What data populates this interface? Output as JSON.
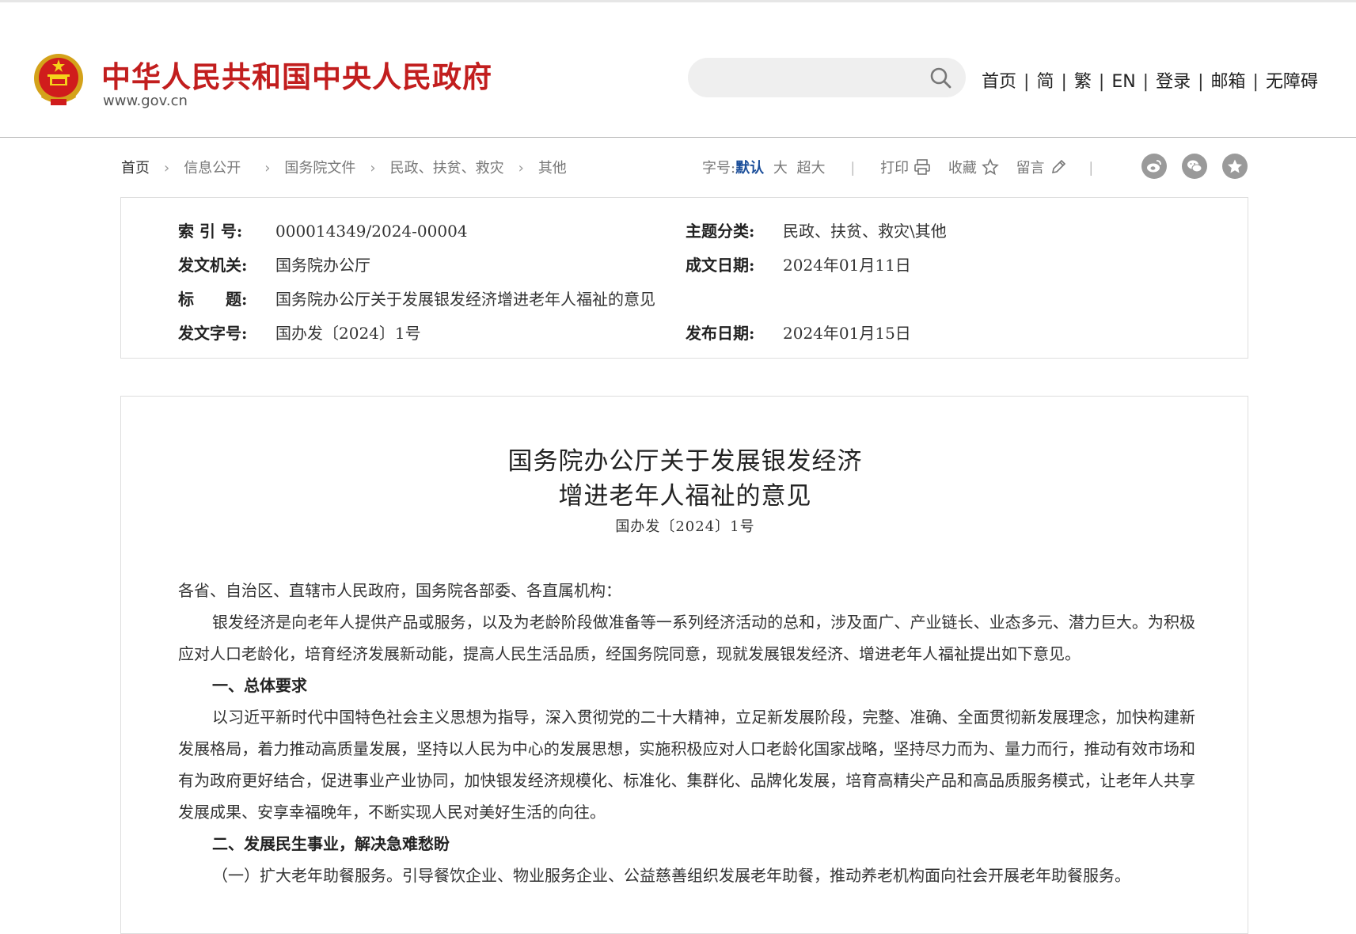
{
  "header": {
    "site_title": "中华人民共和国中央人民政府",
    "site_url": "www.gov.cn",
    "search_placeholder": "",
    "nav": [
      "首页",
      "简",
      "繁",
      "EN",
      "登录",
      "邮箱",
      "无障碍"
    ]
  },
  "breadcrumb": [
    "首页",
    "信息公开",
    "国务院文件",
    "民政、扶贫、救灾",
    "其他"
  ],
  "tools": {
    "font_size_label": "字号:",
    "font_default": "默认",
    "font_large": "大",
    "font_xlarge": "超大",
    "print": "打印",
    "favorite": "收藏",
    "comment": "留言"
  },
  "share_icons": [
    "weibo-icon",
    "wechat-icon",
    "favorite-star-icon"
  ],
  "meta": {
    "index_label": "索 引 号:",
    "index_value": "000014349/2024-00004",
    "topic_label": "主题分类:",
    "topic_value": "民政、扶贫、救灾\\其他",
    "issuer_label": "发文机关:",
    "issuer_value": "国务院办公厅",
    "created_label": "成文日期:",
    "created_value": "2024年01月11日",
    "title_label": "标　　题:",
    "title_value": "国务院办公厅关于发展银发经济增进老年人福祉的意见",
    "docno_label": "发文字号:",
    "docno_value": "国办发〔2024〕1号",
    "published_label": "发布日期:",
    "published_value": "2024年01月15日"
  },
  "article": {
    "title_line1": "国务院办公厅关于发展银发经济",
    "title_line2": "增进老年人福祉的意见",
    "doc_number": "国办发〔2024〕1号",
    "salutation": "各省、自治区、直辖市人民政府，国务院各部委、各直属机构：",
    "para1": "银发经济是向老年人提供产品或服务，以及为老龄阶段做准备等一系列经济活动的总和，涉及面广、产业链长、业态多元、潜力巨大。为积极应对人口老龄化，培育经济发展新动能，提高人民生活品质，经国务院同意，现就发展银发经济、增进老年人福祉提出如下意见。",
    "heading1": "一、总体要求",
    "para2": "以习近平新时代中国特色社会主义思想为指导，深入贯彻党的二十大精神，立足新发展阶段，完整、准确、全面贯彻新发展理念，加快构建新发展格局，着力推动高质量发展，坚持以人民为中心的发展思想，实施积极应对人口老龄化国家战略，坚持尽力而为、量力而行，推动有效市场和有为政府更好结合，促进事业产业协同，加快银发经济规模化、标准化、集群化、品牌化发展，培育高精尖产品和高品质服务模式，让老年人共享发展成果、安享幸福晚年，不断实现人民对美好生活的向往。",
    "heading2": "二、发展民生事业，解决急难愁盼",
    "para3": "（一）扩大老年助餐服务。引导餐饮企业、物业服务企业、公益慈善组织发展老年助餐，推动养老机构面向社会开展老年助餐服务。"
  },
  "colors": {
    "brand_red": "#c21e1e",
    "link_blue": "#1b4e9a",
    "share_gray": "#9a9a9a"
  }
}
